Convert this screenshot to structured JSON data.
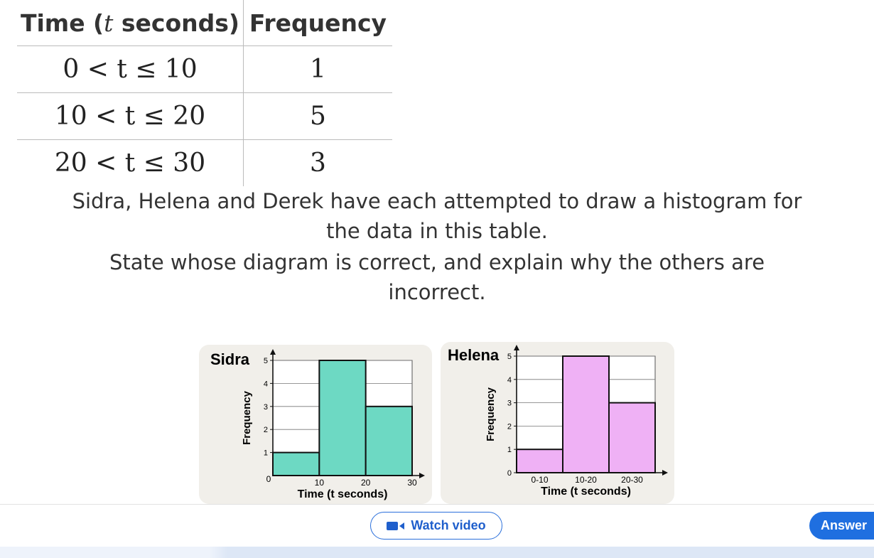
{
  "table": {
    "header_time_prefix": "Time (",
    "header_time_var": "t",
    "header_time_suffix": " seconds)",
    "header_frequency": "Frequency",
    "rows": [
      {
        "interval": "0 < t ≤ 10",
        "frequency": "1"
      },
      {
        "interval": "10 < t ≤ 20",
        "frequency": "5"
      },
      {
        "interval": "20 < t ≤ 30",
        "frequency": "3"
      }
    ]
  },
  "question": {
    "line1": "Sidra, Helena and Derek have each attempted to draw a histogram for",
    "line2": "the data in this table.",
    "line3": "State whose diagram is correct, and explain why the others are",
    "line4": "incorrect."
  },
  "chart_data": [
    {
      "type": "bar",
      "title": "Sidra",
      "categories": [
        "0-10",
        "10-20",
        "20-30"
      ],
      "values": [
        1,
        5,
        3
      ],
      "x_ticks": [
        "0",
        "10",
        "20",
        "30"
      ],
      "y_ticks": [
        "1",
        "2",
        "3",
        "4",
        "5"
      ],
      "xlabel": "Time (t seconds)",
      "ylabel": "Frequency",
      "ylim": [
        0,
        5
      ],
      "bar_color": "#6dd9c3",
      "grid": true
    },
    {
      "type": "bar",
      "title": "Helena",
      "categories": [
        "0-10",
        "10-20",
        "20-30"
      ],
      "values": [
        1,
        5,
        3
      ],
      "x_ticks": [
        "0-10",
        "10-20",
        "20-30"
      ],
      "y_ticks": [
        "0",
        "1",
        "2",
        "3",
        "4",
        "5"
      ],
      "xlabel": "Time (t seconds)",
      "ylabel": "Frequency",
      "ylim": [
        0,
        5
      ],
      "bar_color": "#efb1f5",
      "grid": true
    }
  ],
  "footer": {
    "watch_video_label": "Watch video",
    "answer_label": "Answer",
    "video_icon": "video-camera-icon"
  }
}
